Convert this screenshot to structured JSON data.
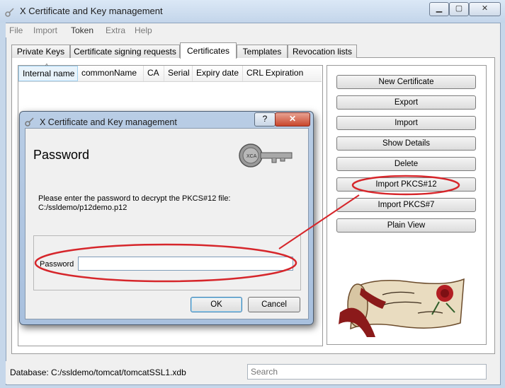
{
  "window": {
    "title": "X Certificate and Key management",
    "caption_buttons": {
      "minimize": "▁",
      "maximize": "▢",
      "close": "✕"
    }
  },
  "menu": [
    "File",
    "Import",
    "Token",
    "Extra",
    "Help"
  ],
  "tabs": [
    {
      "label": "Private Keys",
      "active": false
    },
    {
      "label": "Certificate signing requests",
      "active": false
    },
    {
      "label": "Certificates",
      "active": true
    },
    {
      "label": "Templates",
      "active": false
    },
    {
      "label": "Revocation lists",
      "active": false
    }
  ],
  "certificate_list": {
    "columns": [
      "Internal name",
      "commonName",
      "CA",
      "Serial",
      "Expiry date",
      "CRL Expiration"
    ],
    "sorted_column": "Internal name",
    "rows": []
  },
  "side_buttons": [
    "New Certificate",
    "Export",
    "Import",
    "Show Details",
    "Delete",
    "Import PKCS#12",
    "Import PKCS#7",
    "Plain View"
  ],
  "status": {
    "database": "Database: C:/ssldemo/tomcat/tomcatSSL1.xdb",
    "search_placeholder": "Search"
  },
  "dialog": {
    "title": "X Certificate and Key management",
    "help_button": "?",
    "close_button": "✕",
    "heading": "Password",
    "message_line1": "Please enter the password to decrypt the PKCS#12 file:",
    "message_line2": "C:/ssldemo/p12demo.p12",
    "password_label": "Password",
    "password_value": "",
    "ok_label": "OK",
    "cancel_label": "Cancel",
    "key_icon_text": "XCA"
  },
  "colors": {
    "annotation": "#d6262b",
    "window_frame": "#c6d7ea",
    "dialog_frame": "#b0c6e1",
    "ok_border": "#3c7fb1"
  }
}
